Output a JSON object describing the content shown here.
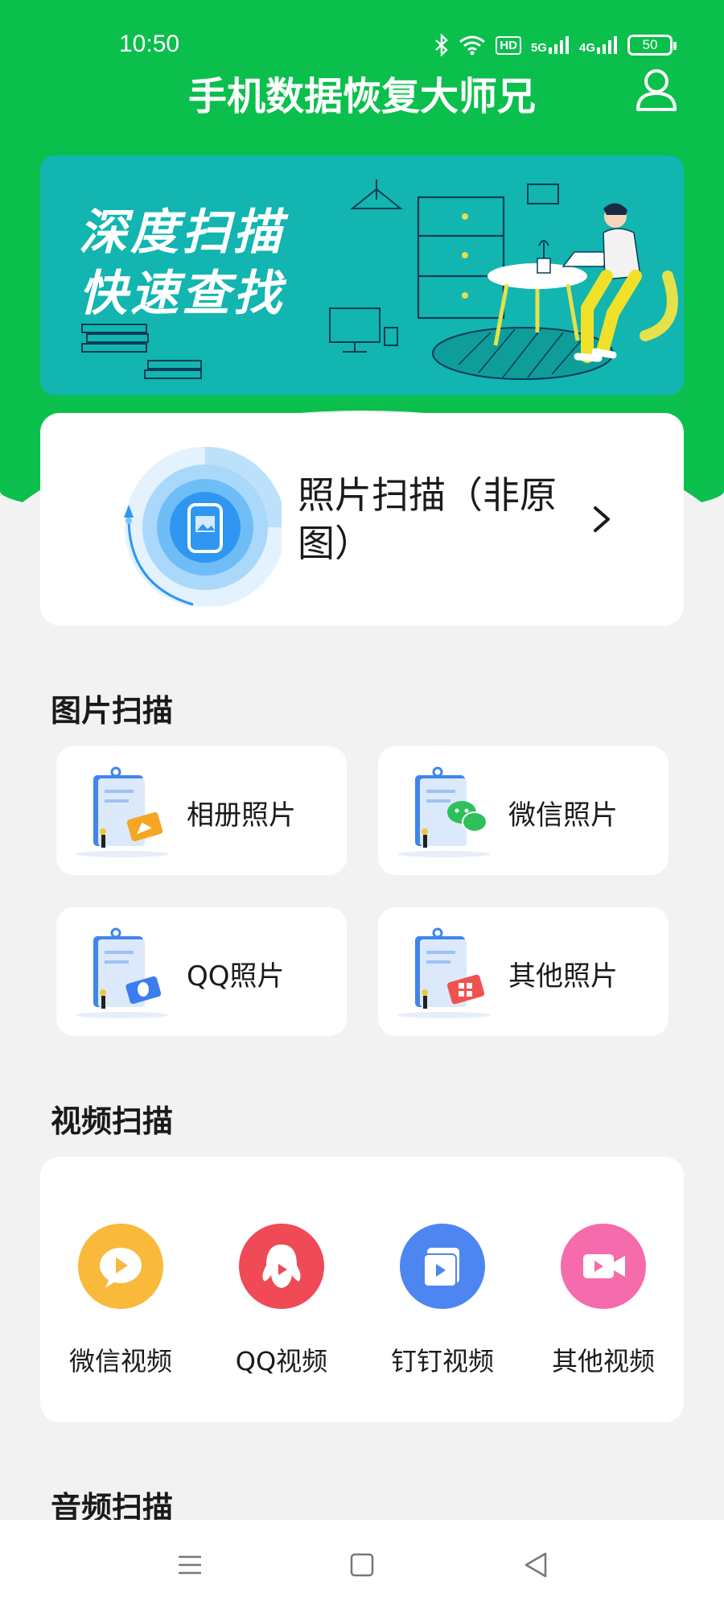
{
  "status_bar": {
    "time": "10:50",
    "hd": "HD",
    "net1": "5G",
    "net2": "4G",
    "battery": "50"
  },
  "header": {
    "title": "手机数据恢复大师兄",
    "user_icon": "user-icon"
  },
  "banner": {
    "line1": "深度扫描",
    "line2": "快速查找"
  },
  "feature": {
    "label": "照片扫描（非原图）"
  },
  "sections": {
    "image_scan": "图片扫描",
    "video_scan": "视频扫描",
    "audio_scan": "音频扫描"
  },
  "photo_items": [
    {
      "label": "相册照片",
      "badge_color": "#f5a623"
    },
    {
      "label": "微信照片",
      "badge_color": "#2ec05a"
    },
    {
      "label": "QQ照片",
      "badge_color": "#3b7cf0"
    },
    {
      "label": "其他照片",
      "badge_color": "#f0524f"
    }
  ],
  "video_items": [
    {
      "label": "微信视频",
      "color": "#f9b93b"
    },
    {
      "label": "QQ视频",
      "color": "#ef4a55"
    },
    {
      "label": "钉钉视频",
      "color": "#4d86f0"
    },
    {
      "label": "其他视频",
      "color": "#f56bab"
    }
  ],
  "colors": {
    "primary_green": "#0bbf4c",
    "banner_teal": "#12b5b0"
  }
}
